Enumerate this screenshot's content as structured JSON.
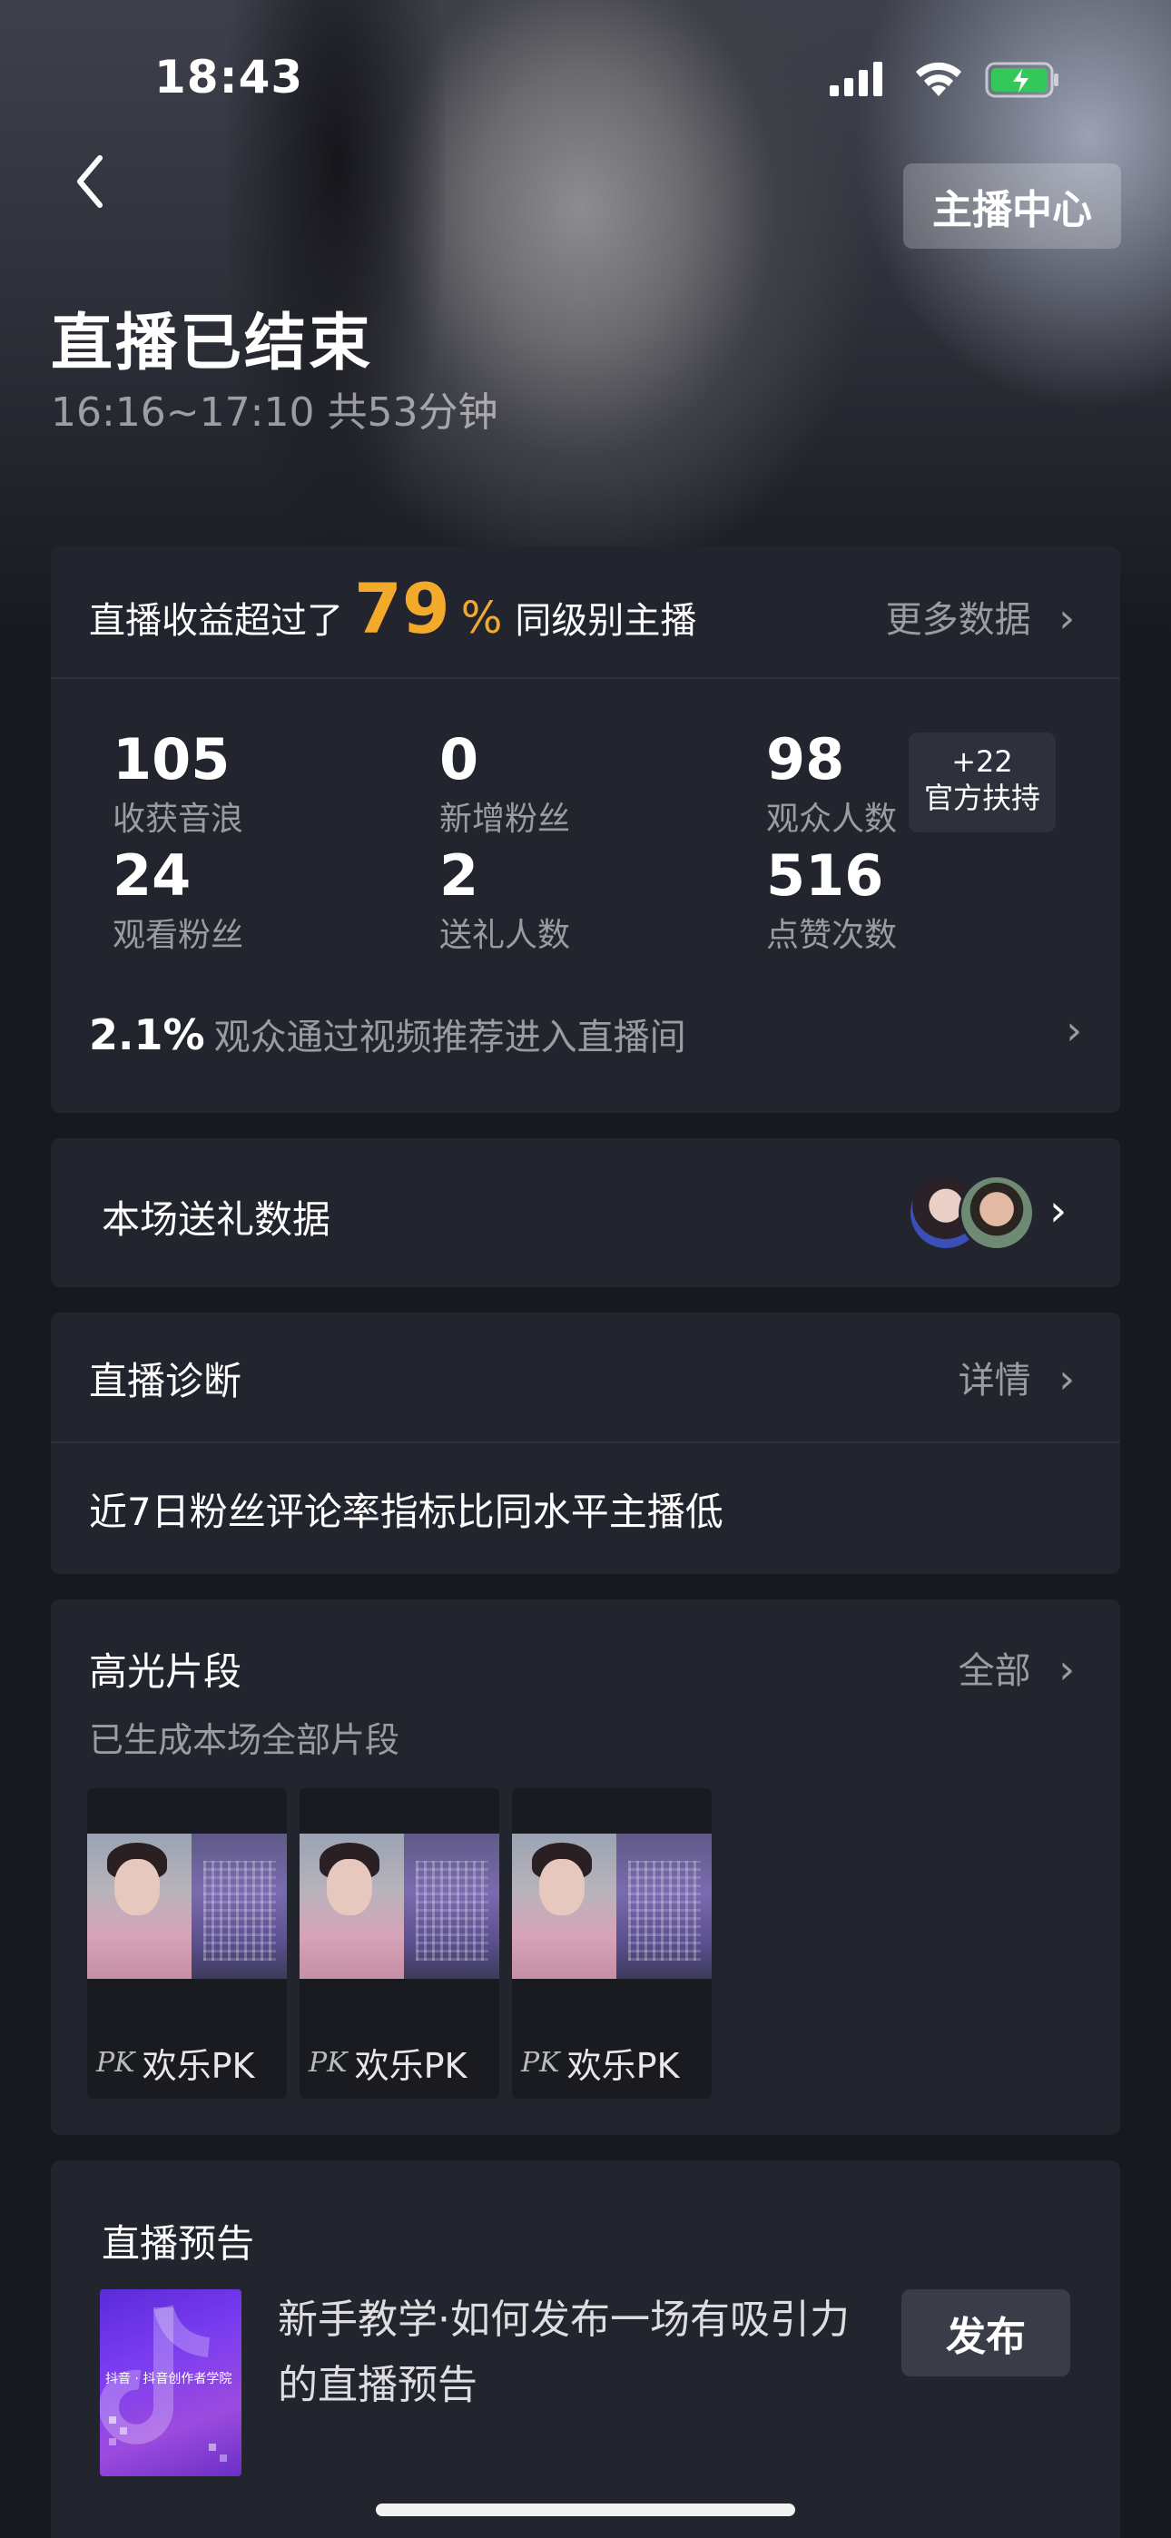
{
  "status_bar": {
    "time": "18:43"
  },
  "header": {
    "host_center_label": "主播中心",
    "title": "直播已结束",
    "subtitle": "16:16~17:10 共53分钟"
  },
  "summary": {
    "prefix": "直播收益超过了",
    "percent": "79",
    "percent_sign": "%",
    "suffix": "同级别主播",
    "more_label": "更多数据",
    "stats": [
      {
        "value": "105",
        "label": "收获音浪"
      },
      {
        "value": "0",
        "label": "新增粉丝"
      },
      {
        "value": "98",
        "label": "观众人数"
      },
      {
        "value": "24",
        "label": "观看粉丝"
      },
      {
        "value": "2",
        "label": "送礼人数"
      },
      {
        "value": "516",
        "label": "点赞次数"
      }
    ],
    "boost": {
      "count": "+22",
      "label": "官方扶持"
    },
    "footer_pct": "2.1%",
    "footer_text": "观众通过视频推荐进入直播间"
  },
  "gift_section": {
    "title": "本场送礼数据"
  },
  "diagnosis": {
    "title": "直播诊断",
    "detail_label": "详情",
    "message": "近7日粉丝评论率指标比同水平主播低"
  },
  "highlights": {
    "title": "高光片段",
    "all_label": "全部",
    "subtitle": "已生成本场全部片段",
    "clips": [
      {
        "icon": "pk-icon",
        "label": "欢乐PK"
      },
      {
        "icon": "pk-icon",
        "label": "欢乐PK"
      },
      {
        "icon": "pk-icon",
        "label": "欢乐PK"
      }
    ]
  },
  "preview": {
    "title": "直播预告",
    "description": "新手教学·如何发布一场有吸引力的直播预告",
    "thumb_caption": "抖音 · 抖音创作者学院",
    "publish_label": "发布"
  },
  "colors": {
    "accent": "#f3aa2b",
    "background": "#171921",
    "card": "#22242e"
  }
}
